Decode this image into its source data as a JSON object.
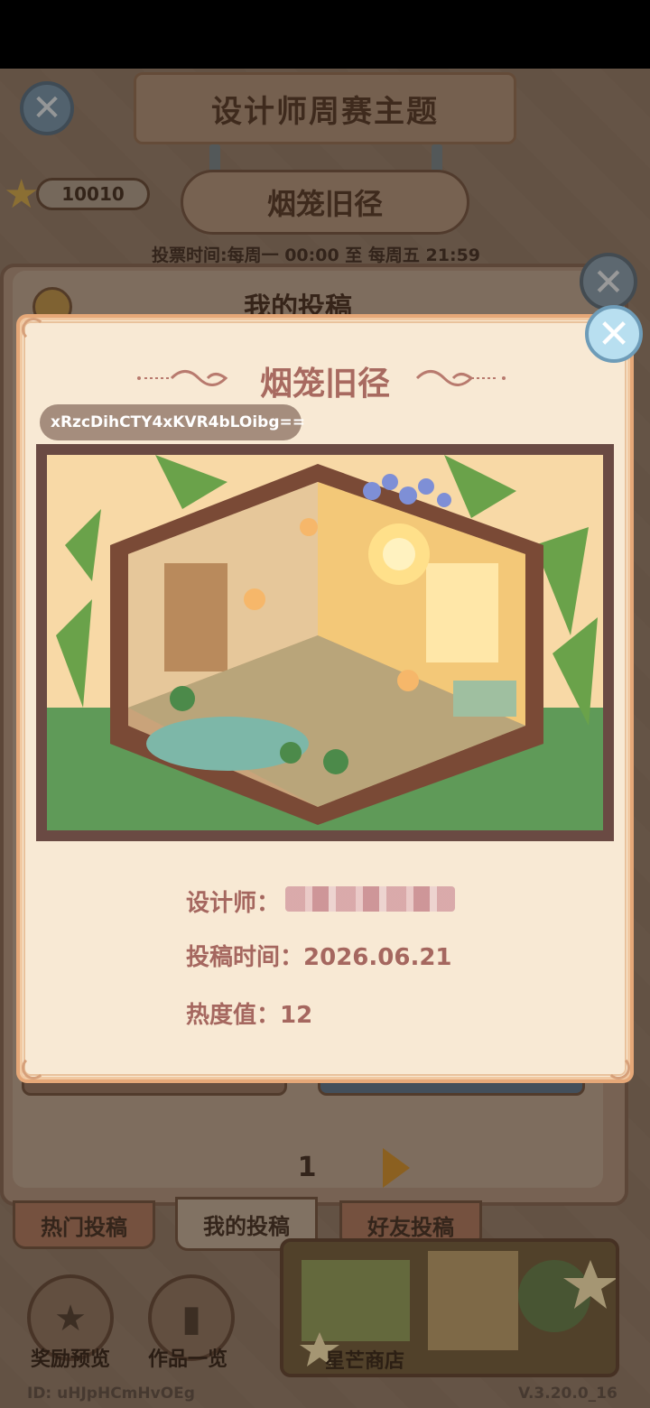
{
  "header": {
    "title": "设计师周赛主题",
    "theme_name": "烟笼旧径",
    "stars": "10010",
    "vote_time": "投票时间:每周一 00:00 至 每周五 21:59"
  },
  "background_panel": {
    "title": "我的投稿",
    "page_number": "1"
  },
  "tabs": [
    {
      "label": "热门投稿"
    },
    {
      "label": "我的投稿"
    },
    {
      "label": "好友投稿"
    }
  ],
  "bottom": {
    "reward_preview": "奖励预览",
    "works_list": "作品一览",
    "star_shop": "星芒商店",
    "player_id": "ID: uHJpHCmHvOEg",
    "version": "V.3.20.0_16"
  },
  "modal": {
    "title": "烟笼旧径",
    "code": "xRzcDihCTY4xKVR4bLOibg==",
    "designer_label": "设计师：",
    "submit_time_label": "投稿时间：",
    "submit_time": "2026.06.21",
    "heat_label": "热度值：",
    "heat_value": "12"
  },
  "colors": {
    "modal_bg": "#f8e9d4",
    "modal_border": "#e6a878",
    "text_accent": "#a5675f",
    "close_button": "#b8dff0"
  }
}
